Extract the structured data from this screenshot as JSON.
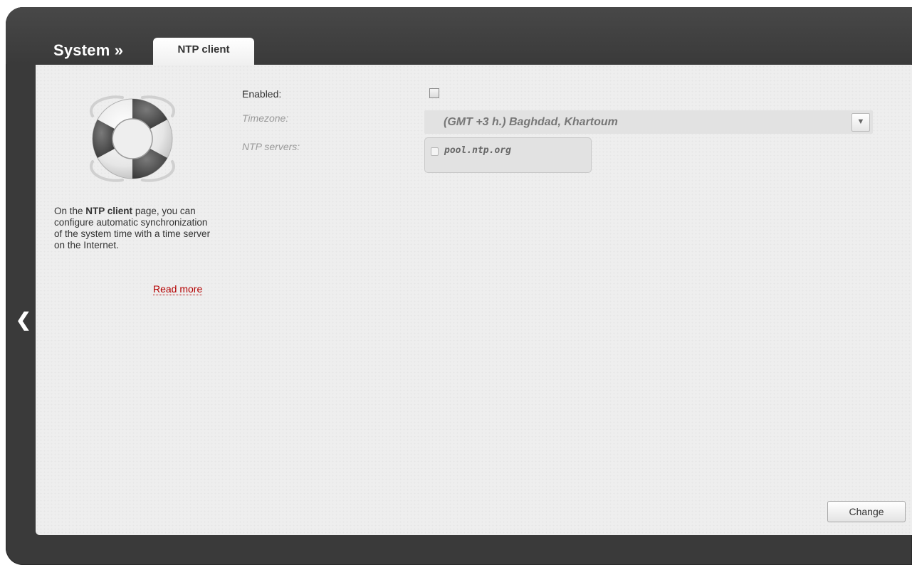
{
  "header": {
    "section_title": "System »",
    "tab_label": "NTP client"
  },
  "sidebar": {
    "help_prefix": "On the ",
    "help_bold": "NTP client",
    "help_suffix": " page, you can configure automatic synchronization of the system time with a time server on the Internet.",
    "read_more_label": "Read more",
    "icon": "lifebuoy-icon"
  },
  "form": {
    "enabled_label": "Enabled:",
    "enabled_checked": false,
    "timezone_label": "Timezone:",
    "timezone_value": "(GMT +3 h.) Baghdad, Khartoum",
    "ntp_servers_label": "NTP servers:",
    "ntp_servers": [
      "pool.ntp.org"
    ]
  },
  "actions": {
    "change_label": "Change"
  },
  "nav": {
    "back_icon": "back-arrow-icon"
  },
  "colors": {
    "frame": "#3a3a3a",
    "panel": "#eeeeee",
    "link": "#b40000"
  }
}
